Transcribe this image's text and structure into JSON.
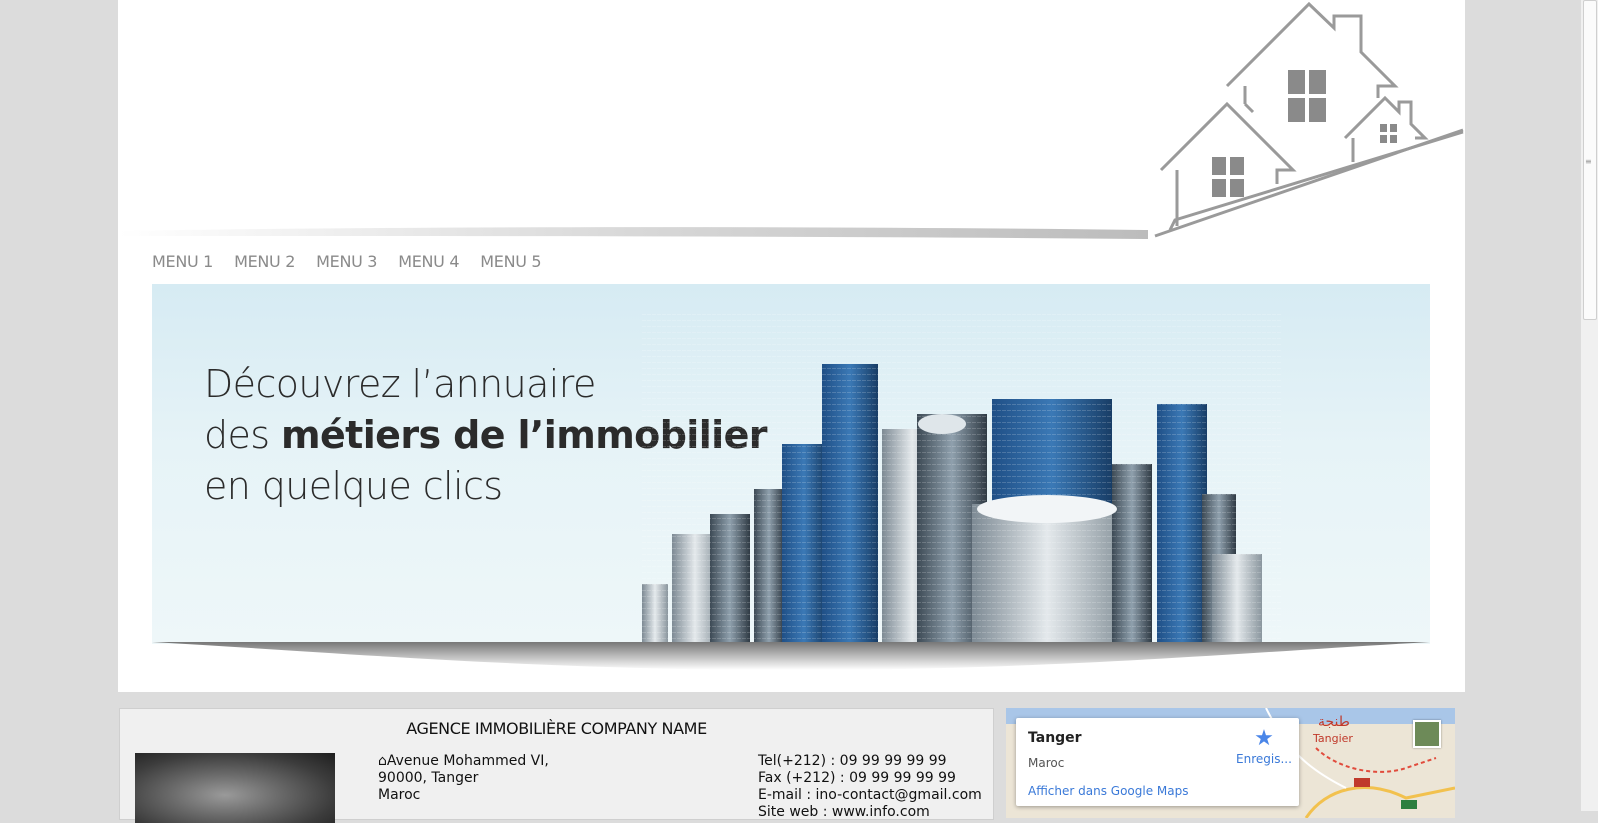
{
  "nav": {
    "items": [
      {
        "label": "MENU 1"
      },
      {
        "label": "MENU 2"
      },
      {
        "label": "MENU 3"
      },
      {
        "label": "MENU 4"
      },
      {
        "label": "MENU 5"
      }
    ]
  },
  "banner": {
    "line1": "Découvrez l’annuaire",
    "line2_pre": "des ",
    "line2_bold": "métiers de l’immobilier",
    "line3": "en quelque clics"
  },
  "company": {
    "title": "AGENCE IMMOBILIÈRE COMPANY NAME",
    "address_icon": "home-icon",
    "address": [
      "Avenue Mohammed VI,",
      "90000, Tanger",
      "Maroc"
    ],
    "contact": [
      "Tel(+212) : 09 99 99 99 99",
      "Fax (+212) : 09 99 99 99 99",
      "E-mail : ino-contact@gmail.com",
      "Site web : www.info.com"
    ]
  },
  "map": {
    "city": "Tanger",
    "country": "Maroc",
    "link": "Afficher dans Google Maps",
    "save_label": "Enregis...",
    "save_icon": "star-icon",
    "label_city_ar": "طنجة",
    "label_city": "Tangier"
  },
  "colors": {
    "nav_text": "#8a8a8a",
    "logo_gray": "#9a9a9a",
    "map_link": "#3a79d8"
  }
}
